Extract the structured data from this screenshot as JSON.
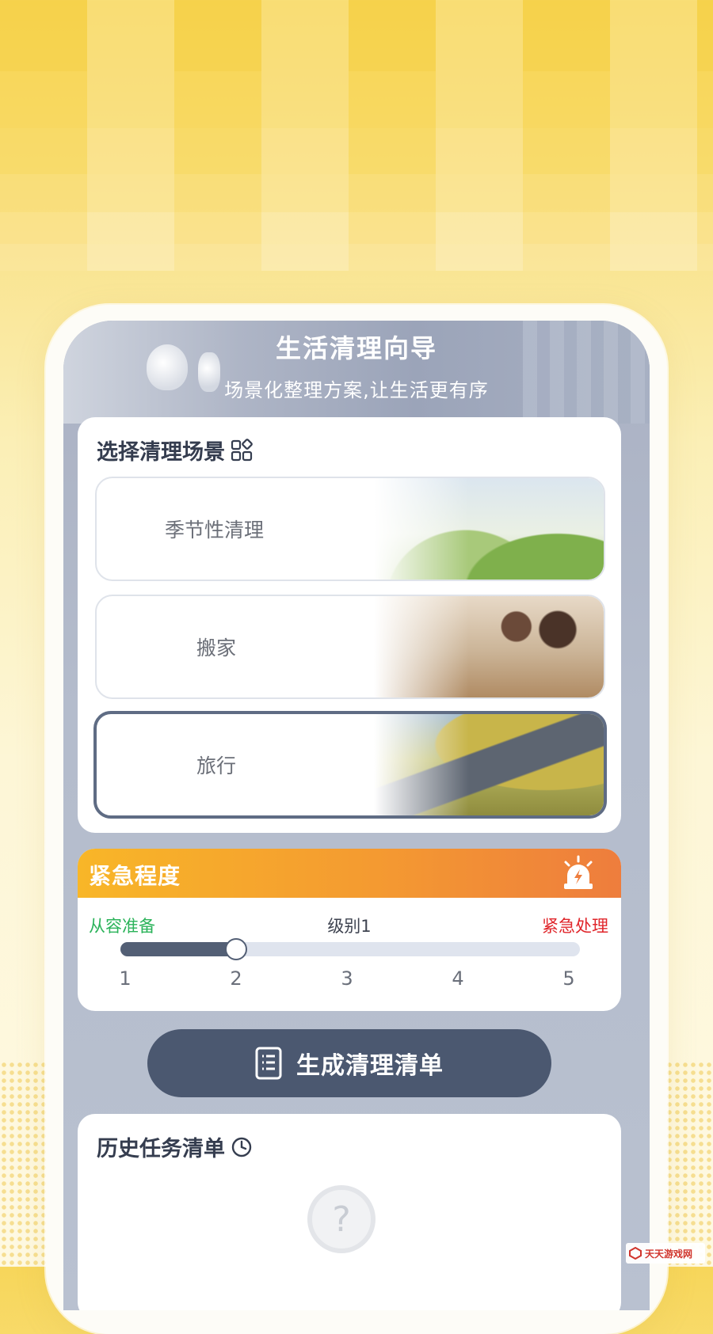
{
  "header": {
    "title": "生活清理向导",
    "subtitle": "场景化整理方案,让生活更有序"
  },
  "scene_section": {
    "title": "选择清理场景",
    "icon": "grid-icon",
    "items": [
      {
        "label": "季节性清理",
        "selected": false,
        "image": "meadow-landscape"
      },
      {
        "label": "搬家",
        "selected": false,
        "image": "family-packing-boxes"
      },
      {
        "label": "旅行",
        "selected": true,
        "image": "car-on-road"
      }
    ]
  },
  "urgency": {
    "title": "紧急程度",
    "icon": "alarm-icon",
    "left_label": "从容准备",
    "level_label": "级别1",
    "right_label": "紧急处理",
    "ticks": [
      "1",
      "2",
      "3",
      "4",
      "5"
    ],
    "slider_value": 2,
    "slider_min": 1,
    "slider_max": 5,
    "colors": {
      "left_label": "#2bb35a",
      "right_label": "#e0262b",
      "header_start": "#f8b628",
      "header_end": "#ee7d3d"
    }
  },
  "generate_button": {
    "label": "生成清理清单",
    "icon": "document-list-icon",
    "color": "#4b5870"
  },
  "history": {
    "title": "历史任务清单",
    "icon": "clock-icon",
    "empty_icon": "question-mark-icon"
  },
  "watermark": {
    "text": "天天游戏网",
    "icon": "logo-icon"
  }
}
